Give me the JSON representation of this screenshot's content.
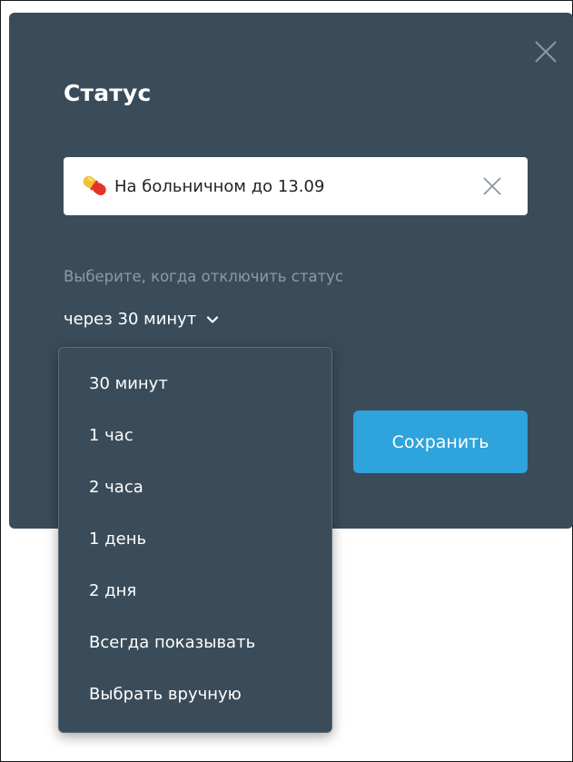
{
  "status_dialog": {
    "title": "Статус",
    "status_input": {
      "emoji_icon": "pill-icon",
      "value": "На больничном до 13.09"
    },
    "expiry_hint": "Выберите, когда отключить статус",
    "expiry_select": {
      "selected": "через 30 минут"
    },
    "save_label": "Сохранить"
  },
  "expiry_options": [
    "30 минут",
    "1 час",
    "2 часа",
    "1 день",
    "2 дня",
    "Всегда показывать",
    "Выбрать вручную"
  ],
  "colors": {
    "panel": "#3a4c5a",
    "accent": "#2ea3dc",
    "hint": "#8e9aa4"
  }
}
